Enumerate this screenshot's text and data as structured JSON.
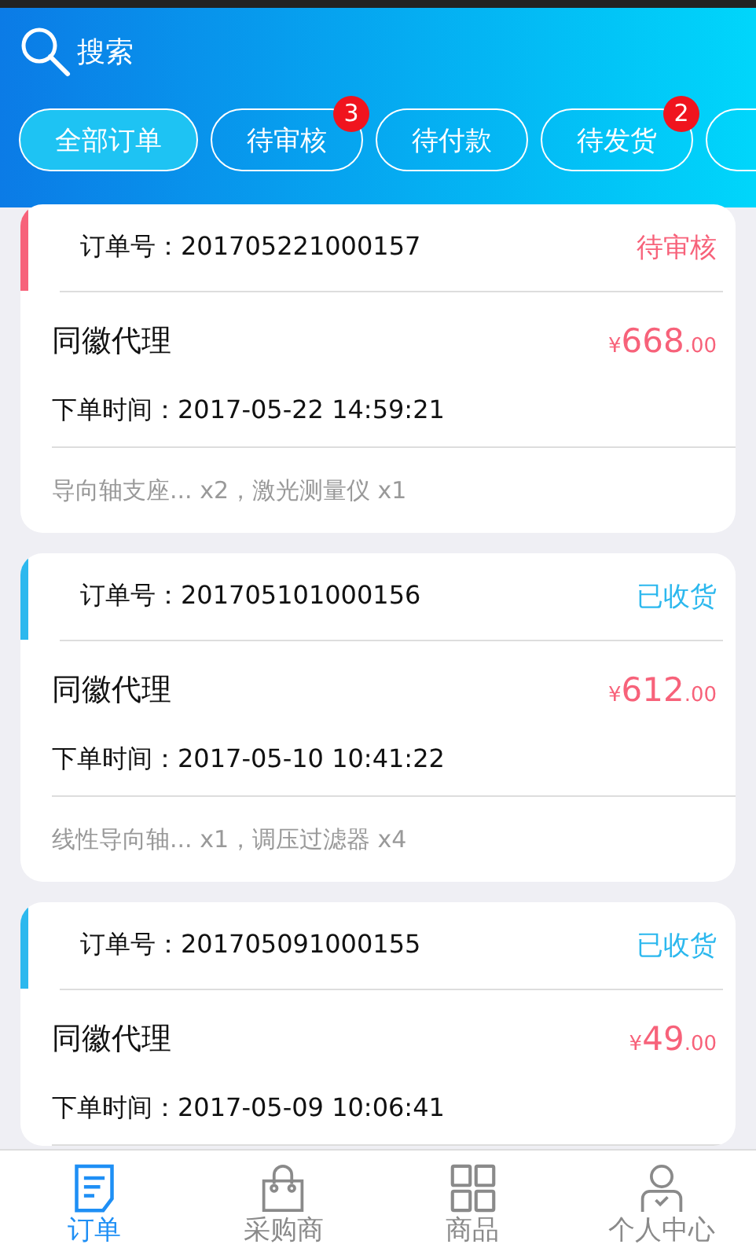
{
  "search": {
    "label": "搜索"
  },
  "filters": [
    {
      "label": "全部订单",
      "selected": true
    },
    {
      "label": "待审核",
      "selected": false,
      "badge": "3"
    },
    {
      "label": "待付款",
      "selected": false
    },
    {
      "label": "待发货",
      "selected": false,
      "badge": "2"
    },
    {
      "selected": false
    }
  ],
  "orders": [
    {
      "number_label": "订单号：",
      "number": "201705221000157",
      "status": "待审核",
      "color": "#f7627a",
      "customer": "同徽代理",
      "currency": "¥",
      "amount": "668",
      "cents": ".00",
      "time_label": "下单时间：",
      "time": "2017-05-22 14:59:21",
      "items": "导向轴支座... x2，激光测量仪 x1"
    },
    {
      "number_label": "订单号：",
      "number": "201705101000156",
      "status": "已收货",
      "color": "#2cb8ee",
      "customer": "同徽代理",
      "currency": "¥",
      "amount": "612",
      "cents": ".00",
      "time_label": "下单时间：",
      "time": "2017-05-10 10:41:22",
      "items": "线性导向轴... x1，调压过滤器 x4"
    },
    {
      "number_label": "订单号：",
      "number": "201705091000155",
      "status": "已收货",
      "color": "#2cb8ee",
      "customer": "同徽代理",
      "currency": "¥",
      "amount": "49",
      "cents": ".00",
      "time_label": "下单时间：",
      "time": "2017-05-09 10:06:41"
    }
  ],
  "nav": [
    {
      "label": "订单",
      "kind": "order",
      "selected": true
    },
    {
      "label": "采购商",
      "kind": "bag",
      "selected": false
    },
    {
      "label": "商品",
      "kind": "grid",
      "selected": false
    },
    {
      "label": "个人中心",
      "kind": "person",
      "selected": false
    }
  ]
}
